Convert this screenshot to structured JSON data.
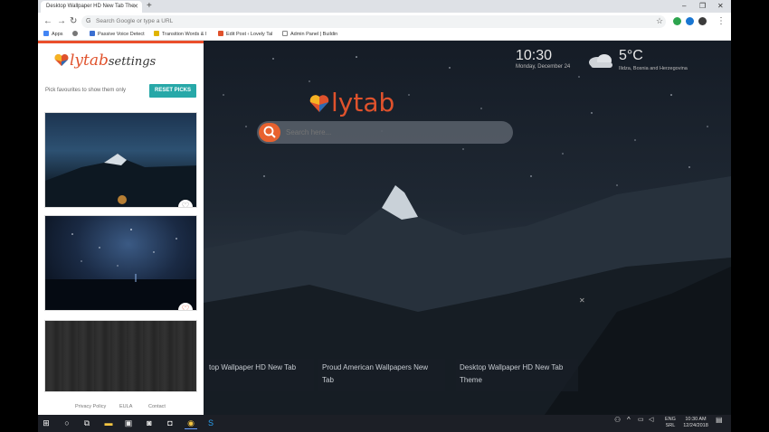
{
  "browser": {
    "tab_title": "Desktop Wallpaper HD New Tab The",
    "omnibox_placeholder": "Search Google or type a URL",
    "bookmarks": [
      {
        "label": "Apps",
        "color": "#4285f4"
      },
      {
        "label": "",
        "color": "#777"
      },
      {
        "label": "Passive Voice Detect",
        "color": "#3b6fd1"
      },
      {
        "label": "Transition Words & I",
        "color": "#e0b400"
      },
      {
        "label": "Edit Post ‹ Lovely Tal",
        "color": "#e0522c"
      },
      {
        "label": "Admin Panel | Buildin",
        "color": "#888"
      }
    ]
  },
  "newtab": {
    "time": "10:30",
    "date": "Monday, December 24",
    "temperature": "5°C",
    "location": "Ilidza, Bosnia and Herzegovina",
    "brand": "lytab",
    "search_placeholder": "Search here...",
    "thumbnails": [
      {
        "label": "top Wallpaper HD New Tab"
      },
      {
        "label": "Proud American Wallpapers New Tab"
      },
      {
        "label": "Desktop Wallpaper HD New Tab Theme"
      }
    ]
  },
  "settings": {
    "logo_brand": "lytab",
    "logo_suffix": "settings",
    "hint": "Pick favourites to show them only",
    "reset_label": "RESET PICKS",
    "footer": {
      "privacy": "Privacy Policy",
      "eula": "EULA",
      "contact": "Contact"
    }
  },
  "taskbar": {
    "lang": "ENG",
    "region": "SRL",
    "time": "10:30 AM",
    "date": "12/24/2018"
  },
  "colors": {
    "accent": "#e0522c",
    "teal": "#27a8a8"
  }
}
